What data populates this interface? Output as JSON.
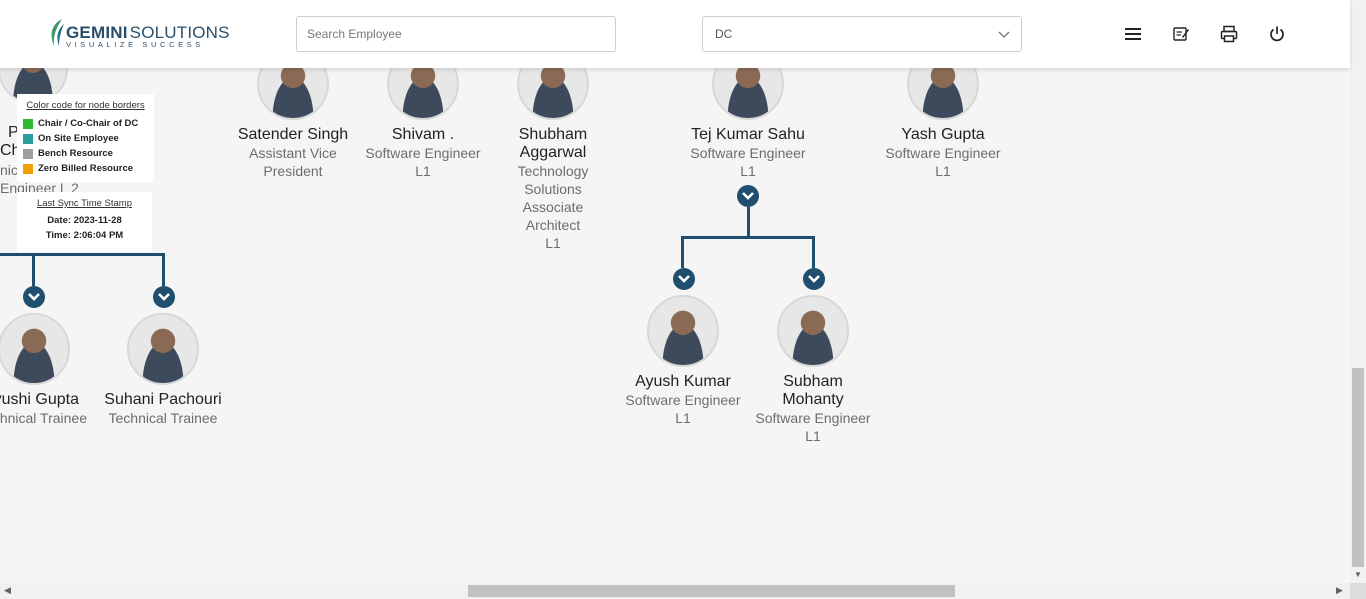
{
  "header": {
    "logo_main": "GEMINI",
    "logo_sub": "SOLUTIONS",
    "logo_tag": "VISUALIZE SUCCESS",
    "search_placeholder": "Search Employee",
    "dropdown_value": "DC",
    "icons": [
      "menu-icon",
      "edit-note-icon",
      "print-icon",
      "power-icon"
    ]
  },
  "legend": {
    "title": "Color code for node borders",
    "items": [
      {
        "label": "Chair / Co-Chair of DC",
        "color": "#2db82d"
      },
      {
        "label": "On Site Employee",
        "color": "#2a9d9d"
      },
      {
        "label": "Bench Resource",
        "color": "#9e9e9e"
      },
      {
        "label": "Zero Billed Resource",
        "color": "#f0a000"
      }
    ]
  },
  "sync": {
    "title": "Last Sync Time Stamp",
    "date": "Date: 2023-11-28",
    "time": "Time: 2:06:04 PM"
  },
  "partial_left": {
    "name_frag1": "P",
    "name_frag2": "Cha",
    "role_frag1": "nic",
    "role_frag2": "Engineer L 2"
  },
  "nodes": {
    "satender": {
      "name": "Satender Singh",
      "role": "Assistant Vice President"
    },
    "shivam": {
      "name": "Shivam .",
      "role": "Software Engineer",
      "level": "L1"
    },
    "shubham": {
      "name": "Shubham Aggarwal",
      "role": "Technology Solutions Associate Architect",
      "level": "L1"
    },
    "tej": {
      "name": "Tej Kumar Sahu",
      "role": "Software Engineer",
      "level": "L1"
    },
    "yash": {
      "name": "Yash Gupta",
      "role": "Software Engineer",
      "level": "L1"
    },
    "ayush": {
      "name": "Ayush Kumar",
      "role": "Software Engineer",
      "level": "L1"
    },
    "subham": {
      "name": "Subham Mohanty",
      "role": "Software Engineer",
      "level": "L1"
    },
    "vyushi": {
      "name": "yushi Gupta",
      "role": "hnical Trainee"
    },
    "suhani": {
      "name": "Suhani Pachouri",
      "role": "Technical Trainee"
    }
  }
}
